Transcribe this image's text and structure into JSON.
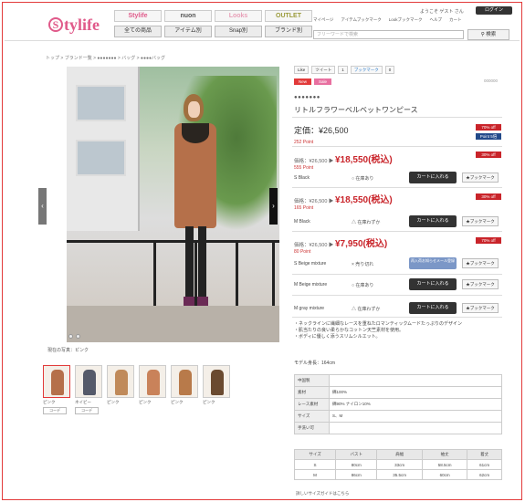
{
  "header": {
    "logo": "Stylife",
    "brand_tabs": [
      "Stylife",
      "nuon",
      "Looks",
      "OUTLET"
    ],
    "nav_tabs": [
      "全ての商品",
      "アイテム別",
      "Snap別",
      "ブランド別"
    ],
    "top_links": [
      "マイページ",
      "アイテムブックマーク",
      "Lookブックマーク",
      "ヘルプ",
      "カート"
    ],
    "welcome": "ようこそ ゲスト さん",
    "login": "ログイン",
    "search_placeholder": "フリーワードで検索",
    "search_button": "検索"
  },
  "breadcrumb": "トップ > ブランド一覧 > ●●●●●●● > バッグ > ●●●●バッグ",
  "gallery": {
    "prev": "‹",
    "next": "›",
    "color_caption": "現在の写真：ピンク",
    "thumbnails": [
      {
        "label": "ピンク",
        "mini": "コーデ"
      },
      {
        "label": "ネイビー",
        "mini": "コーデ"
      },
      {
        "label": "ピンク",
        "mini": ""
      },
      {
        "label": "ピンク",
        "mini": ""
      },
      {
        "label": "ピンク",
        "mini": ""
      },
      {
        "label": "ピンク",
        "mini": ""
      }
    ]
  },
  "social": [
    "Like",
    "ツイート",
    "1",
    "ブックマーク",
    "0"
  ],
  "badges": [
    "New",
    "Sale"
  ],
  "sku": "000000",
  "product": {
    "brand": "●●●●●●●",
    "name": "リトルフラワーベルベットワンピース",
    "regular_label": "定価：¥26,500",
    "regular_points": "252 Point",
    "tag1": "70% off",
    "tag2": "Point 5倍"
  },
  "variants": [
    {
      "old": "価格：¥26,500 ▶",
      "price": "¥18,550(税込)",
      "points": "555 Point",
      "tag": "30% off",
      "color": "S Black",
      "stock": "○ 在庫あり",
      "cart": "カートに入れる",
      "bookmark": "★ブックマーク"
    },
    {
      "old": "価格：¥26,500 ▶",
      "price": "¥18,550(税込)",
      "points": "165 Point",
      "tag": "30% off",
      "color": "M Black",
      "stock": "△ 在庫わずか",
      "cart": "カートに入れる",
      "bookmark": "★ブックマーク"
    },
    {
      "old": "価格：¥26,500 ▶",
      "price": "¥7,950(税込)",
      "points": "80 Point",
      "tag": "70% off",
      "color": "S Beige mixture",
      "stock": "× 売り切れ",
      "cart": "再入荷お知らせメール登録",
      "bookmark": "★ブックマーク"
    },
    {
      "old": "",
      "price": "",
      "points": "",
      "tag": "",
      "color": "M Beige mixture",
      "stock": "○ 在庫あり",
      "cart": "カートに入れる",
      "bookmark": "★ブックマーク"
    },
    {
      "old": "",
      "price": "",
      "points": "",
      "tag": "",
      "color": "M gray mixture",
      "stock": "△ 在庫わずか",
      "cart": "カートに入れる",
      "bookmark": "★ブックマーク"
    }
  ],
  "description": [
    "・ネックラインに繊細なレースを重ねたロマンティックムードたっぷりのデザイン",
    "・肌当たりの良い柔らかなコットン天竺素材を使用。",
    "・ボディに優しく添うスリムシルエット。"
  ],
  "model": "モデル身長：164cm",
  "specs": [
    {
      "k": "中国製",
      "v": ""
    },
    {
      "k": "素材",
      "v": "綿100%"
    },
    {
      "k": "レース素材",
      "v": "綿90% ナイロン10%"
    },
    {
      "k": "サイズ",
      "v": "S、M"
    },
    {
      "k": "手洗い可",
      "v": ""
    }
  ],
  "size_table": {
    "headers": [
      "サイズ",
      "バスト",
      "肩幅",
      "袖丈",
      "着丈"
    ],
    "rows": [
      [
        "S",
        "80cm",
        "33cm",
        "58.5cm",
        "61cm"
      ],
      [
        "M",
        "86cm",
        "35.5cm",
        "60cm",
        "62cm"
      ]
    ]
  },
  "size_link": "詳しいサイズガイドはこちら",
  "colors": {
    "accent": "#e23a3a",
    "price": "#c9242a",
    "logo": "#e05a8a"
  }
}
